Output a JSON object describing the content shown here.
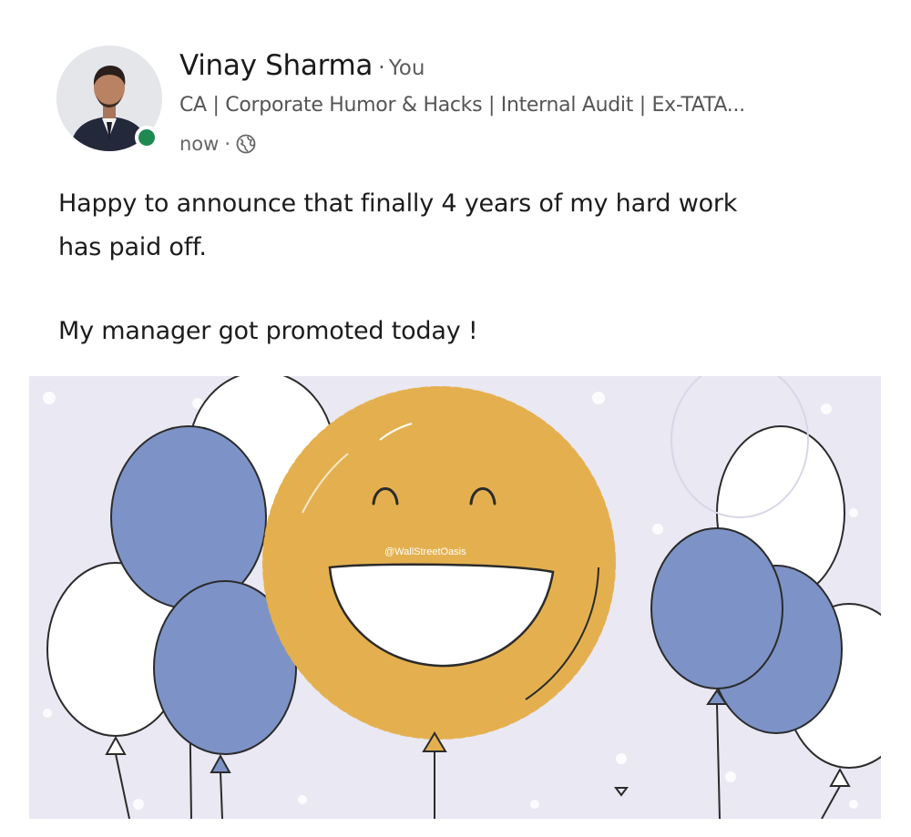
{
  "author": {
    "name": "Vinay Sharma",
    "relation": "You",
    "headline": "CA | Corporate Humor & Hacks | Internal Audit | Ex-TATA...",
    "time": "now",
    "visibility_icon": "globe-icon",
    "presence": "online"
  },
  "post": {
    "line1": "Happy to announce that finally 4 years of my hard work",
    "line2": "has paid off.",
    "line3": "My manager got promoted today !"
  },
  "image": {
    "watermark": "@WallStreetOasis",
    "subject": "smiley-balloon",
    "colors": {
      "balloon_blue": "#7d93c7",
      "smiley_gold": "#e4b04f",
      "background": "#e9e8f3"
    }
  }
}
